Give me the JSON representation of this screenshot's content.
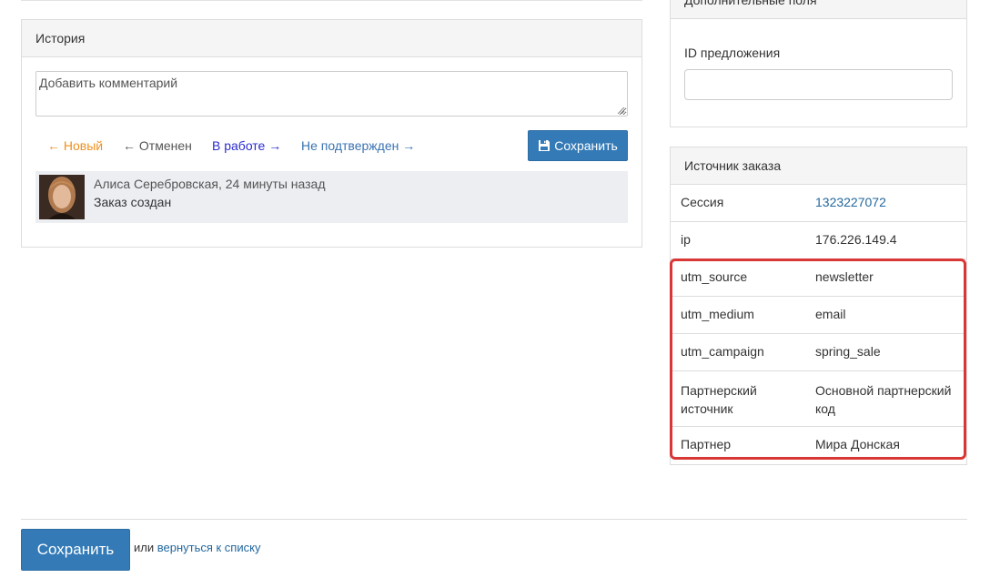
{
  "history": {
    "title": "История",
    "comment_placeholder": "Добавить комментарий",
    "statuses": [
      {
        "label": "Новый",
        "arrow": "←",
        "color": "#f0901e"
      },
      {
        "label": "Отменен",
        "arrow": "←",
        "color": "#555555"
      },
      {
        "label": "В работе",
        "arrow": "→",
        "color": "#2b2bd0"
      },
      {
        "label": "Не подтвержден",
        "arrow": "→",
        "color": "#3a73b2"
      }
    ],
    "save_label": "Сохранить",
    "entry": {
      "author": "Алиса Серебровская, 24 минуты назад",
      "text": "Заказ создан"
    }
  },
  "extra_fields": {
    "title": "Дополнительные поля",
    "offer_id_label": "ID предложения",
    "offer_id_value": ""
  },
  "source": {
    "title": "Источник заказа",
    "rows": [
      {
        "key": "Сессия",
        "value": "1323227072",
        "link": true
      },
      {
        "key": "ip",
        "value": "176.226.149.4",
        "link": false
      },
      {
        "key": "utm_source",
        "value": "newsletter",
        "link": false
      },
      {
        "key": "utm_medium",
        "value": "email",
        "link": false
      },
      {
        "key": "utm_campaign",
        "value": "spring_sale",
        "link": false
      },
      {
        "key": "Партнерский источник",
        "value": "Основной партнерский код",
        "link": false
      },
      {
        "key": "Партнер",
        "value": "Мира Донская",
        "link": false
      }
    ],
    "highlight_color": "#d93636"
  },
  "footer": {
    "save_label": "Сохранить",
    "or_text": "или",
    "back_link": "вернуться к списку"
  },
  "colors": {
    "primary": "#337ab7",
    "link": "#23689e"
  }
}
